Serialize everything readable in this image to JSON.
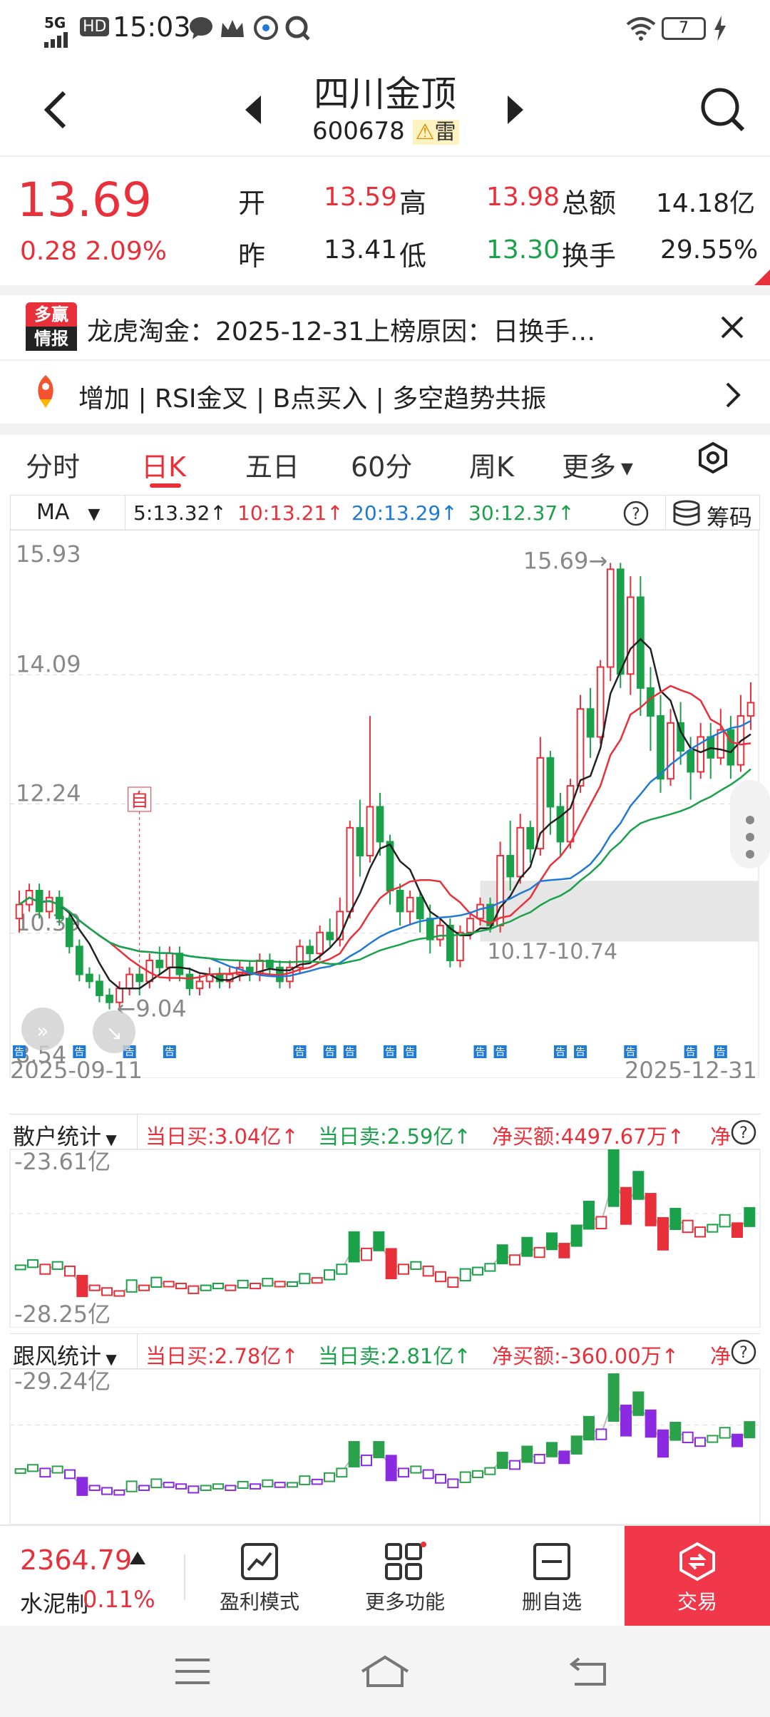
{
  "status": {
    "network": "5G",
    "hd": "HD",
    "time": "15:03",
    "battery": "7"
  },
  "header": {
    "name": "四川金顶",
    "code": "600678",
    "warn_label": "雷"
  },
  "quote": {
    "price": "13.69",
    "change": "0.28",
    "change_pct": "2.09%",
    "open_label": "开",
    "open": "13.59",
    "high_label": "高",
    "high": "13.98",
    "prev_label": "昨",
    "prev": "13.41",
    "low_label": "低",
    "low": "13.30",
    "amount_label": "总额",
    "amount": "14.18亿",
    "turnover_label": "换手",
    "turnover": "29.55%"
  },
  "news": {
    "logo_top": "多赢",
    "logo_bottom": "情报",
    "text": "龙虎淘金：2025-12-31上榜原因：日换手…"
  },
  "signals": {
    "text": "增加 | RSI金叉 | B点买入 | 多空趋势共振"
  },
  "tabs": [
    {
      "label": "分时"
    },
    {
      "label": "日K"
    },
    {
      "label": "五日"
    },
    {
      "label": "60分"
    },
    {
      "label": "周K"
    },
    {
      "label": "更多"
    }
  ],
  "ma": {
    "label": "MA",
    "ma5": "5:13.32↑",
    "ma10": "10:13.21↑",
    "ma20": "20:13.29↑",
    "ma30": "30:12.37↑",
    "chips_label": "筹码"
  },
  "chart_data": {
    "type": "candlestick",
    "price_axis": [
      "15.93",
      "14.09",
      "12.24",
      "10.39",
      "8.54"
    ],
    "date_start": "2025-09-11",
    "date_end": "2025-12-31",
    "max_label": "15.69→",
    "min_label": "←9.04",
    "range_label": "10.17-10.74",
    "self_tag": "自",
    "notice_tag": "告",
    "candles": [
      [
        10.6,
        10.8,
        11.0,
        10.4
      ],
      [
        10.8,
        11.0,
        11.1,
        10.7
      ],
      [
        11.0,
        10.7,
        11.1,
        10.6
      ],
      [
        10.7,
        10.9,
        11.0,
        10.6
      ],
      [
        10.9,
        10.6,
        11.0,
        10.5
      ],
      [
        10.6,
        10.2,
        10.7,
        10.1
      ],
      [
        10.2,
        9.8,
        10.3,
        9.7
      ],
      [
        9.8,
        9.7,
        9.9,
        9.6
      ],
      [
        9.7,
        9.5,
        9.8,
        9.4
      ],
      [
        9.5,
        9.4,
        9.6,
        9.3
      ],
      [
        9.4,
        9.6,
        9.7,
        9.3
      ],
      [
        9.6,
        9.8,
        9.9,
        9.5
      ],
      [
        9.8,
        9.7,
        9.9,
        9.5
      ],
      [
        9.7,
        10.0,
        10.1,
        9.6
      ],
      [
        10.0,
        9.9,
        10.2,
        9.8
      ],
      [
        9.9,
        10.1,
        10.2,
        9.7
      ],
      [
        10.1,
        9.8,
        10.2,
        9.7
      ],
      [
        9.8,
        9.6,
        9.9,
        9.5
      ],
      [
        9.6,
        9.7,
        9.8,
        9.5
      ],
      [
        9.7,
        9.8,
        9.9,
        9.6
      ],
      [
        9.8,
        9.7,
        9.9,
        9.6
      ],
      [
        9.7,
        9.8,
        9.9,
        9.6
      ],
      [
        9.8,
        9.9,
        10.0,
        9.7
      ],
      [
        9.9,
        9.8,
        10.0,
        9.7
      ],
      [
        9.8,
        10.0,
        10.1,
        9.7
      ],
      [
        10.0,
        9.9,
        10.1,
        9.8
      ],
      [
        9.9,
        9.7,
        10.0,
        9.6
      ],
      [
        9.7,
        9.9,
        10.0,
        9.6
      ],
      [
        9.9,
        10.2,
        10.3,
        9.8
      ],
      [
        10.2,
        10.1,
        10.3,
        10.0
      ],
      [
        10.1,
        10.4,
        10.5,
        10.0
      ],
      [
        10.4,
        10.3,
        10.6,
        10.2
      ],
      [
        10.3,
        10.7,
        10.9,
        10.2
      ],
      [
        10.7,
        11.9,
        12.0,
        10.6
      ],
      [
        11.9,
        11.5,
        12.3,
        11.2
      ],
      [
        11.5,
        12.2,
        13.5,
        11.4
      ],
      [
        12.2,
        11.7,
        12.4,
        11.5
      ],
      [
        11.7,
        11.0,
        11.8,
        10.8
      ],
      [
        11.0,
        10.7,
        11.1,
        10.5
      ],
      [
        10.7,
        10.9,
        11.0,
        10.5
      ],
      [
        10.9,
        10.6,
        11.0,
        10.4
      ],
      [
        10.6,
        10.3,
        10.8,
        10.1
      ],
      [
        10.3,
        10.5,
        10.6,
        10.2
      ],
      [
        10.5,
        10.0,
        10.6,
        9.9
      ],
      [
        10.0,
        10.4,
        10.5,
        9.9
      ],
      [
        10.4,
        10.6,
        10.7,
        10.3
      ],
      [
        10.6,
        10.8,
        10.9,
        10.5
      ],
      [
        10.8,
        10.5,
        10.9,
        10.4
      ],
      [
        10.5,
        11.5,
        11.7,
        10.4
      ],
      [
        11.5,
        11.2,
        12.0,
        11.0
      ],
      [
        11.2,
        11.9,
        12.1,
        11.1
      ],
      [
        11.9,
        11.6,
        12.0,
        11.4
      ],
      [
        11.6,
        12.9,
        13.2,
        11.5
      ],
      [
        12.9,
        12.2,
        13.0,
        11.8
      ],
      [
        12.2,
        11.7,
        12.4,
        11.5
      ],
      [
        11.7,
        12.5,
        12.6,
        11.6
      ],
      [
        12.5,
        13.6,
        13.8,
        12.4
      ],
      [
        13.6,
        13.2,
        13.9,
        12.9
      ],
      [
        13.2,
        14.2,
        14.3,
        13.1
      ],
      [
        14.2,
        15.6,
        15.69,
        14.0
      ],
      [
        15.6,
        14.1,
        15.69,
        13.9
      ],
      [
        14.1,
        15.2,
        15.5,
        13.8
      ],
      [
        15.2,
        13.9,
        15.5,
        13.5
      ],
      [
        13.9,
        13.5,
        14.2,
        13.0
      ],
      [
        13.5,
        12.6,
        13.8,
        12.4
      ],
      [
        12.6,
        13.4,
        13.6,
        12.5
      ],
      [
        13.4,
        13.0,
        13.7,
        12.8
      ],
      [
        13.0,
        12.7,
        13.2,
        12.3
      ],
      [
        12.7,
        13.2,
        13.4,
        12.6
      ],
      [
        13.2,
        12.9,
        13.4,
        12.6
      ],
      [
        12.9,
        13.3,
        13.6,
        12.8
      ],
      [
        13.3,
        12.8,
        13.5,
        12.6
      ],
      [
        12.8,
        13.5,
        13.8,
        12.7
      ],
      [
        13.5,
        13.69,
        13.98,
        13.3
      ]
    ],
    "retail_panel": {
      "label": "散户统计",
      "buy": "当日买:3.04亿↑",
      "sell": "当日卖:2.59亿↑",
      "net": "净买额:4497.67万↑",
      "net2": "净",
      "top": "-23.61亿",
      "bottom": "-28.25亿"
    },
    "follow_panel": {
      "label": "跟风统计",
      "buy": "当日买:2.78亿↑",
      "sell": "当日卖:2.81亿↑",
      "net": "净买额:-360.00万↑",
      "net2": "净",
      "top": "-29.24亿"
    }
  },
  "bottom": {
    "index_value": "2364.79",
    "index_name": "水泥制",
    "index_pct": "0.11%",
    "btn_profit": "盈利模式",
    "btn_more": "更多功能",
    "btn_del": "删自选",
    "btn_trade": "交易"
  }
}
